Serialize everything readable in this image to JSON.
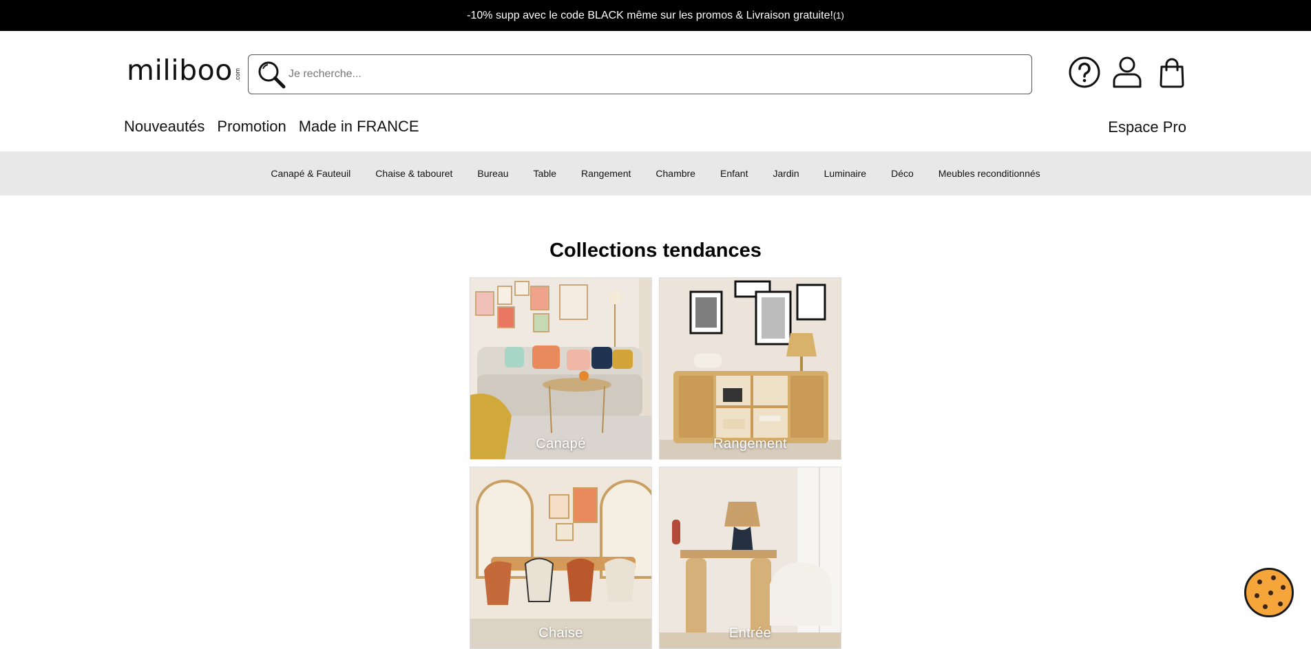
{
  "announcement": {
    "text": "-10% supp avec le code BLACK même sur les promos & Livraison gratuite!",
    "sup": "(1)"
  },
  "logo": {
    "word": "miliboo",
    "tld": ".com"
  },
  "search": {
    "placeholder": "Je recherche...",
    "icon": "search-icon"
  },
  "header_icons": [
    {
      "name": "help-icon"
    },
    {
      "name": "account-icon"
    },
    {
      "name": "cart-icon"
    }
  ],
  "main_nav": {
    "items": [
      "Nouveautés",
      "Promotion",
      "Made in FRANCE"
    ],
    "pro_label": "Espace Pro"
  },
  "categories": [
    "Canapé & Fauteuil",
    "Chaise & tabouret",
    "Bureau",
    "Table",
    "Rangement",
    "Chambre",
    "Enfant",
    "Jardin",
    "Luminaire",
    "Déco",
    "Meubles reconditionnés"
  ],
  "collections": {
    "title": "Collections tendances",
    "tiles": [
      {
        "label": "Canapé"
      },
      {
        "label": "Rangement"
      },
      {
        "label": "Chaise"
      },
      {
        "label": "Entrée"
      }
    ]
  },
  "colors": {
    "announcement_bg": "#000000",
    "category_bar_bg": "#e8e8e8",
    "cookie": "#f6a53a"
  }
}
